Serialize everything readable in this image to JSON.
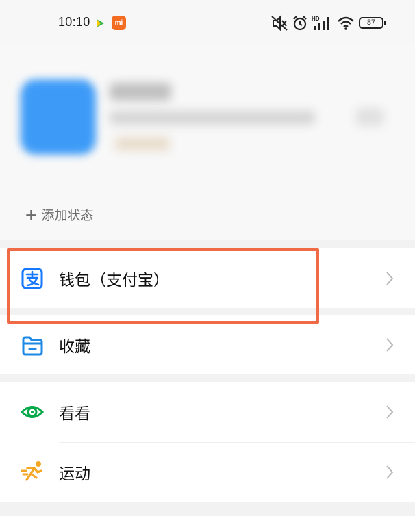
{
  "status_bar": {
    "time": "10:10",
    "mi_badge": "mi",
    "battery": "87",
    "icons": [
      "play-icon",
      "mi-icon",
      "mute-icon",
      "alarm-icon",
      "signal-icon",
      "wifi-icon",
      "battery-icon"
    ]
  },
  "profile": {
    "add_status": "添加状态"
  },
  "menu": [
    {
      "label": "钱包（支付宝）",
      "icon": "alipay-wallet-icon"
    },
    {
      "label": "收藏",
      "icon": "folder-favorites-icon"
    },
    {
      "label": "看看",
      "icon": "eye-icon"
    },
    {
      "label": "运动",
      "icon": "running-icon"
    }
  ],
  "colors": {
    "highlight": "#f06b45",
    "alipay_blue": "#1677ff",
    "favorites_blue": "#1e88e5",
    "look_green": "#07a84a",
    "sport_orange": "#f5a623"
  }
}
